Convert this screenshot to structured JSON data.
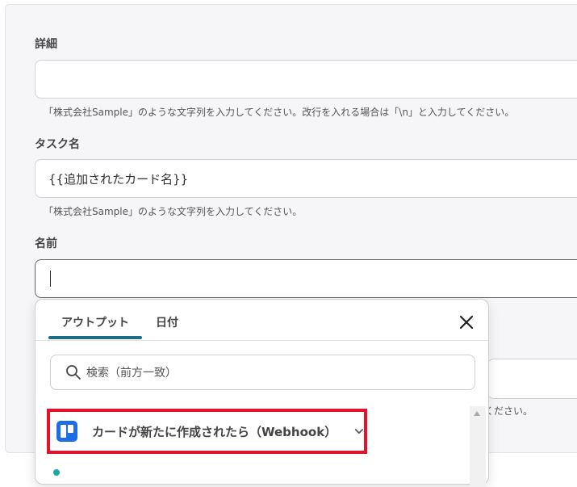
{
  "fields": {
    "detail": {
      "label": "詳細",
      "value": "",
      "hint": "「株式会社Sample」のような文字列を入力してください。改行を入れる場合は「\\n」と入力してください。"
    },
    "task_name": {
      "label": "タスク名",
      "value": "{{追加されたカード名}}",
      "hint": "「株式会社Sample」のような文字列を入力してください。"
    },
    "name": {
      "label": "名前",
      "value": ""
    },
    "partial_hint": "ください。"
  },
  "popup": {
    "tabs": [
      {
        "label": "アウトプット",
        "active": true
      },
      {
        "label": "日付",
        "active": false
      }
    ],
    "search_placeholder": "検索（前方一致）",
    "items": [
      {
        "label": "カードが新たに作成されたら（Webhook）",
        "icon": "trello-icon",
        "highlighted": true
      }
    ]
  },
  "colors": {
    "accent": "#1f6b8c",
    "highlight": "#e0142a",
    "trello": "#1d6ee6"
  }
}
